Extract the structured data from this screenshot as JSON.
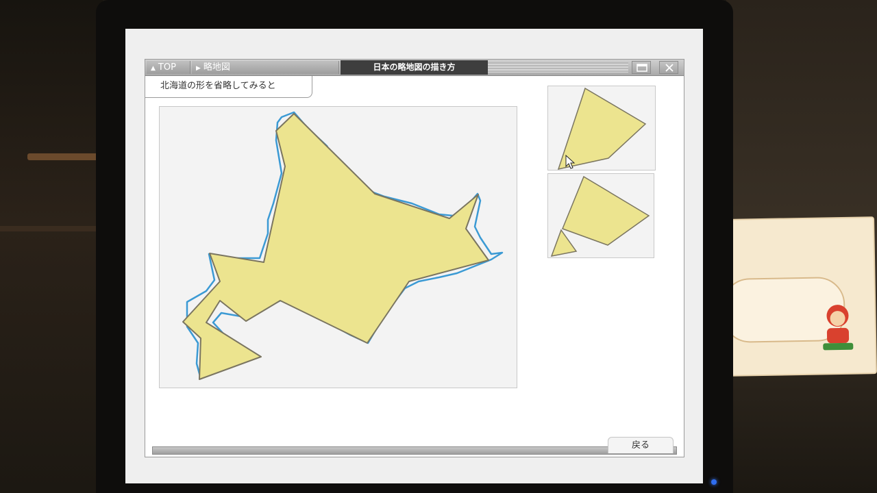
{
  "app": {
    "title": "日本の略地図の描き方"
  },
  "nav": {
    "top_label": "TOP",
    "section_label": "略地図"
  },
  "content": {
    "subtitle": "北海道の形を省略してみると"
  },
  "footer": {
    "back_label": "戻る"
  },
  "colors": {
    "shape_fill": "#ece48f",
    "shape_stroke": "#7a7560",
    "outline_blue": "#3b9ad4",
    "title_bg": "#3e3e3e"
  },
  "icons": {
    "top": "triangle-up-icon",
    "section": "triangle-right-icon",
    "maximize": "window-icon",
    "close": "close-icon",
    "cursor": "pointer-cursor-icon"
  }
}
